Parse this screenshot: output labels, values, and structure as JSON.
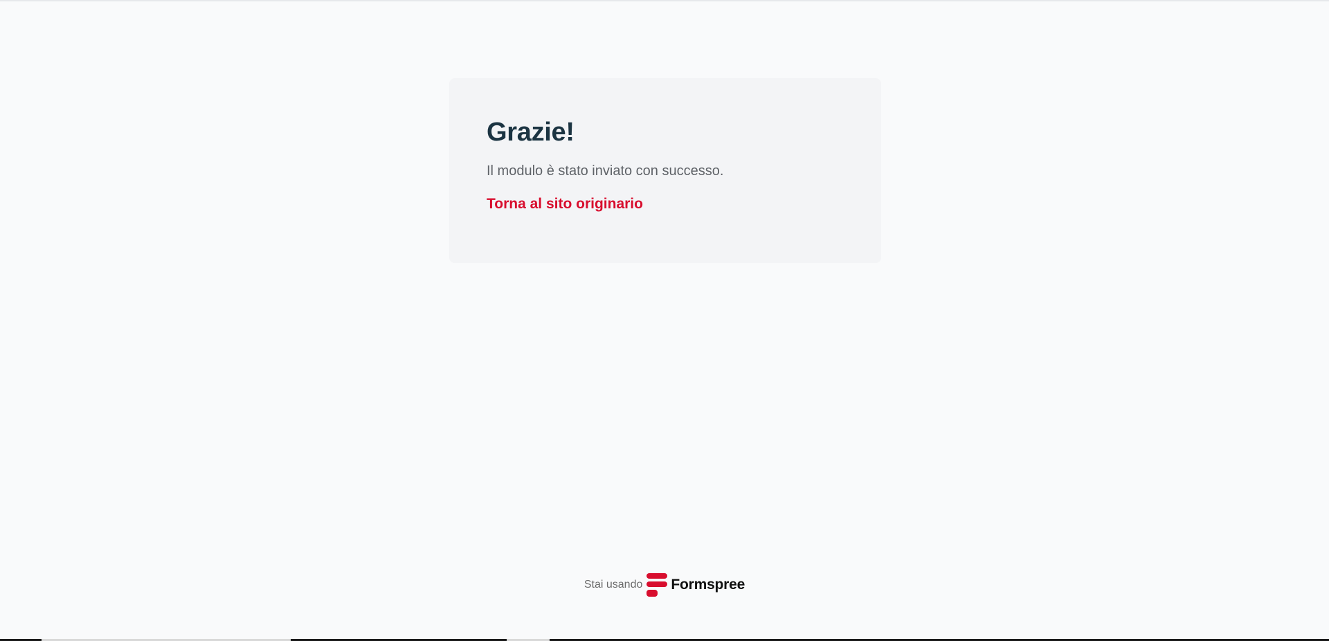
{
  "card": {
    "title": "Grazie!",
    "message": "Il modulo è stato inviato con successo.",
    "back_link_label": "Torna al sito originario"
  },
  "footer": {
    "prefix": "Stai usando",
    "brand_name": "Formspree",
    "brand_icon": "formspree-logo-icon"
  },
  "colors": {
    "background": "#f9fafb",
    "card_background": "#f3f4f6",
    "title": "#1b3442",
    "message": "#5f6368",
    "link": "#d80e2e",
    "brand": "#d80e2e"
  }
}
